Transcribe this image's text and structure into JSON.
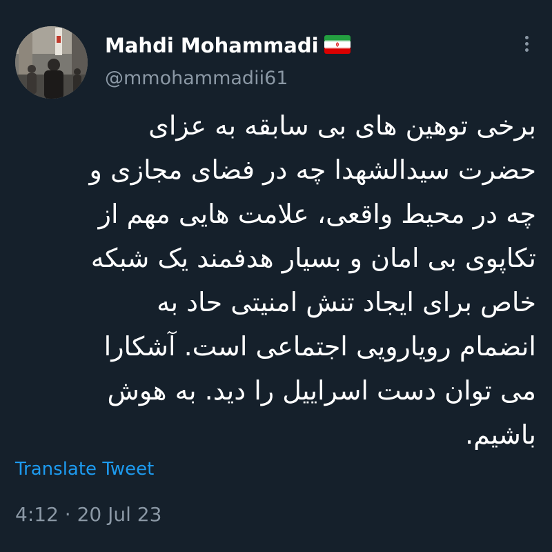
{
  "author": {
    "display_name": "Mahdi Mohammadi",
    "handle": "@mmohammadii61",
    "flag_icon": "iran-flag-icon"
  },
  "tweet": {
    "text": "برخی توهین های بی سابقه به عزای\nحضرت سیدالشهدا چه در فضای مجازی و\nچه در محیط واقعی، علامت هایی مهم از\nتکاپوی بی امان و بسیار هدفمند یک شبکه\nخاص برای ایجاد تنش امنیتی حاد به\nانضمام رویارویی اجتماعی است. آشکارا\nمی توان دست اسراییل را دید. به هوش\nباشیم.",
    "translate_label": "Translate Tweet",
    "timestamp": "4:12 · 20 Jul 23"
  },
  "icons": {
    "more": "more-options-icon"
  },
  "colors": {
    "background": "#15202b",
    "primary_text": "#ffffff",
    "secondary_text": "#8b98a5",
    "link": "#1d9bf0"
  }
}
